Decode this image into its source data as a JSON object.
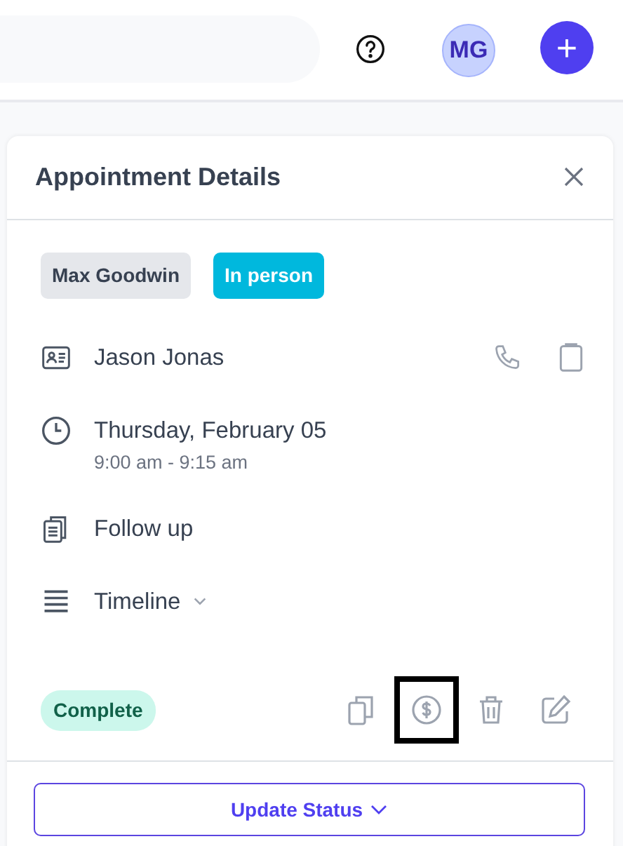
{
  "topbar": {
    "avatar_initials": "MG",
    "add_button": "+"
  },
  "panel": {
    "title": "Appointment Details",
    "tags": [
      {
        "label": "Max Goodwin",
        "color": "#e5e7eb"
      },
      {
        "label": "In person",
        "color": "#00b8dd"
      }
    ],
    "details": [
      {
        "kind": "client",
        "text": "Jason Jonas"
      },
      {
        "kind": "datetime",
        "text": "Thursday, February 05",
        "subtext": "9:00 am - 9:15 am"
      },
      {
        "kind": "type",
        "text": "Follow up"
      },
      {
        "kind": "timeline",
        "text": "Timeline",
        "expanded": false
      }
    ],
    "status": "Complete",
    "actions": [
      {
        "kind": "copy",
        "highlighted": false
      },
      {
        "kind": "payment",
        "highlighted": true
      },
      {
        "kind": "delete",
        "highlighted": false
      },
      {
        "kind": "edit",
        "highlighted": false
      }
    ],
    "update_button": "Update Status"
  }
}
